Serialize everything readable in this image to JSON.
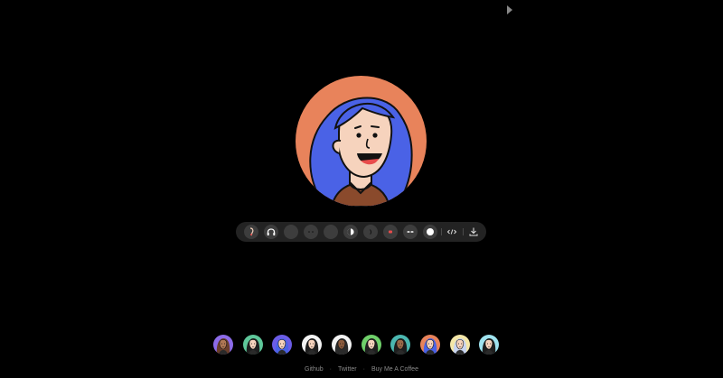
{
  "avatar": {
    "background_color": "#e8835b",
    "hair_color": "#4a62e6",
    "skin_color": "#f6d3bd",
    "shirt_color": "#8a4a2c"
  },
  "toolbar": {
    "buttons": [
      {
        "name": "ear-option-button",
        "icon": "ear-icon"
      },
      {
        "name": "earring-option-button",
        "icon": "headphones-icon"
      },
      {
        "name": "eyebrows-option-button",
        "icon": "blank-icon"
      },
      {
        "name": "eyes-option-button",
        "icon": "eyes-icon"
      },
      {
        "name": "glasses-option-button",
        "icon": "blank-icon"
      },
      {
        "name": "face-option-button",
        "icon": "face-icon"
      },
      {
        "name": "nose-option-button",
        "icon": "nose-icon"
      },
      {
        "name": "mouth-option-button",
        "icon": "mouth-icon"
      },
      {
        "name": "beard-option-button",
        "icon": "mustache-icon"
      },
      {
        "name": "shirt-option-button",
        "icon": "circle-icon"
      }
    ],
    "code_action": {
      "icon": "code-icon"
    },
    "download_action": {
      "icon": "download-icon"
    }
  },
  "gallery": {
    "thumbnails": [
      {
        "bg": "#8c6be8",
        "hair": "#6a3e2a",
        "skin": "#b07754"
      },
      {
        "bg": "#5ec79a",
        "hair": "#1e1e1e",
        "skin": "#f6d3bd"
      },
      {
        "bg": "#6b5ce6",
        "hair": "#4a62e6",
        "skin": "#f6d3bd"
      },
      {
        "bg": "#f3f3f3",
        "hair": "#1e1e1e",
        "skin": "#f6d3bd"
      },
      {
        "bg": "#f3f3f3",
        "hair": "#2a2a2a",
        "skin": "#8a5a3c"
      },
      {
        "bg": "#6fd06a",
        "hair": "#1e1e1e",
        "skin": "#f6d3bd"
      },
      {
        "bg": "#4bb7b0",
        "hair": "#1e1e1e",
        "skin": "#9a6a4a"
      },
      {
        "bg": "#e8835b",
        "hair": "#4a62e6",
        "skin": "#f6d3bd"
      },
      {
        "bg": "#f4e7a8",
        "hair": "#c8d4f0",
        "skin": "#f6d3bd"
      },
      {
        "bg": "#9fe3ef",
        "hair": "#1e1e1e",
        "skin": "#f6d3bd"
      }
    ],
    "next_icon": "chevron-right-icon"
  },
  "footer": {
    "links": [
      "Github",
      "Twitter",
      "Buy Me A Coffee"
    ],
    "separator": "·"
  }
}
